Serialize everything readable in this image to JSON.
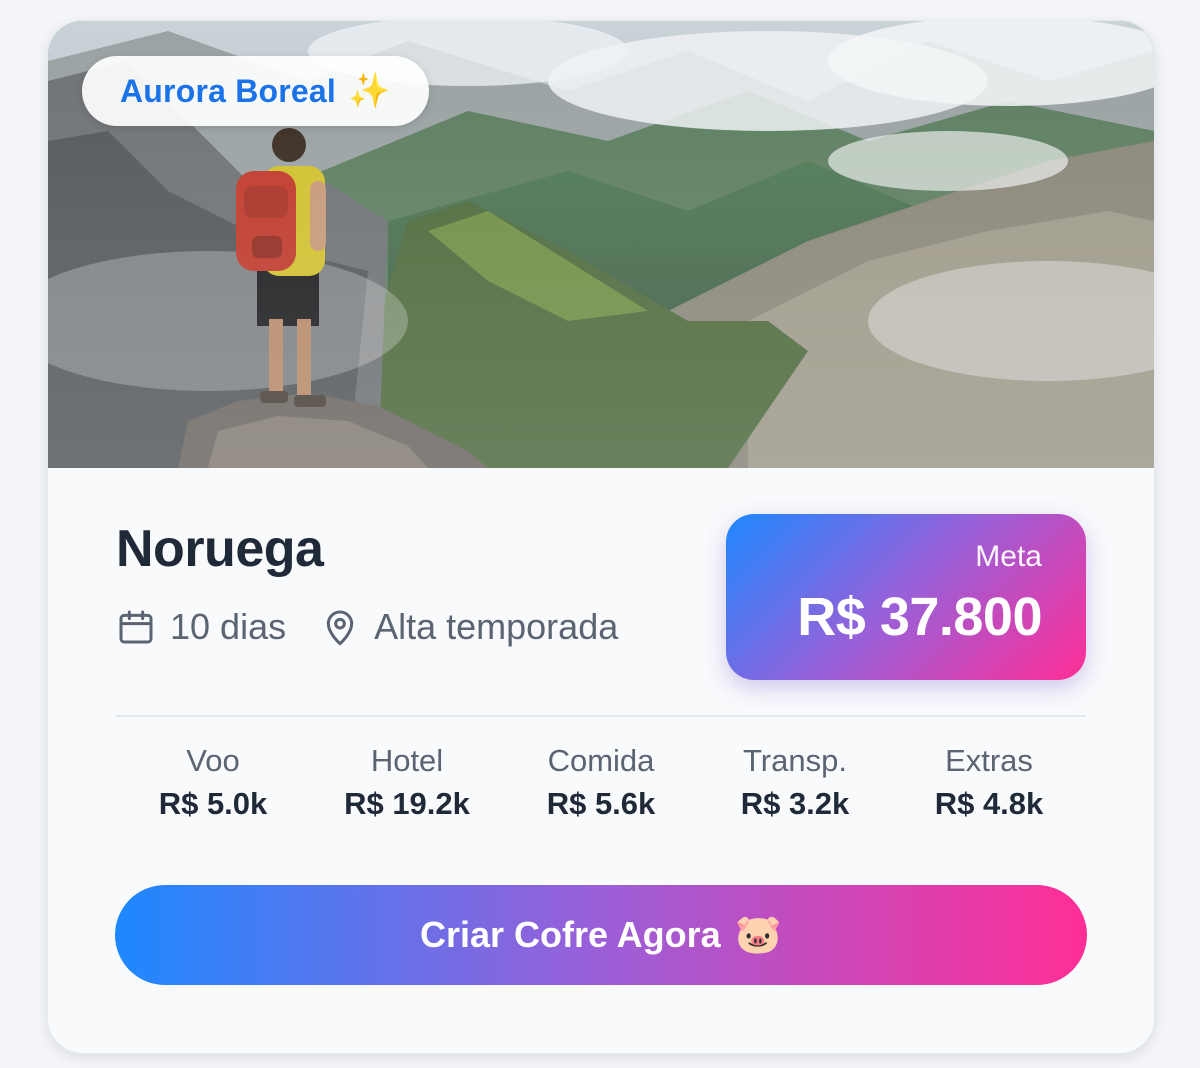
{
  "card": {
    "badge": {
      "label": "Aurora Boreal",
      "icon_glyph": "✨",
      "icon_name": "sparkles-icon"
    },
    "image": {
      "description_name": "hero-image"
    },
    "destination": "Noruega",
    "duration": {
      "icon_name": "calendar-icon",
      "text": "10 dias"
    },
    "season": {
      "icon_name": "location-pin-icon",
      "text": "Alta temporada"
    },
    "goal": {
      "label": "Meta",
      "value": "R$ 37.800"
    },
    "costs": [
      {
        "label": "Voo",
        "value": "R$ 5.0k"
      },
      {
        "label": "Hotel",
        "value": "R$ 19.2k"
      },
      {
        "label": "Comida",
        "value": "R$ 5.6k"
      },
      {
        "label": "Transp.",
        "value": "R$ 3.2k"
      },
      {
        "label": "Extras",
        "value": "R$ 4.8k"
      }
    ],
    "cta": {
      "label": "Criar Cofre Agora",
      "icon_glyph": "🐷",
      "icon_name": "pig-icon"
    }
  },
  "colors": {
    "accent_blue": "#1e88ff",
    "accent_purple": "#9b5fd8",
    "accent_pink": "#ff2e96",
    "text_dark": "#1f2937",
    "text_muted": "#5b6472"
  }
}
